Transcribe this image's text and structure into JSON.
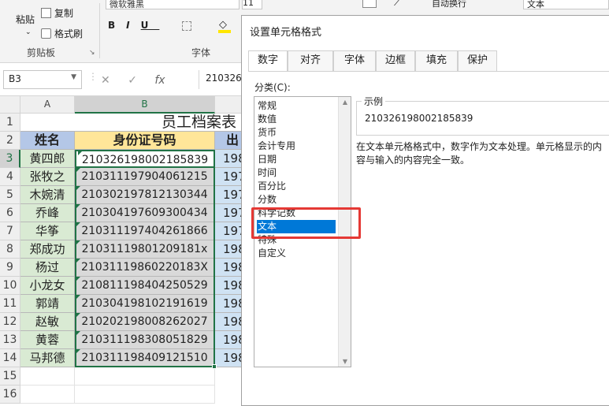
{
  "ribbon": {
    "paste": "粘贴",
    "copy": "复制",
    "format_painter": "格式刷",
    "clipboard_group": "剪贴板",
    "font_name": "微软雅黑",
    "font_size": "11",
    "bold": "B",
    "italic": "I",
    "underline": "U",
    "font_group": "字体",
    "wrap_text": "自动换行",
    "number_format": "文本"
  },
  "formula_bar": {
    "name_box": "B3",
    "fx": "fx",
    "value": "210326198002185839"
  },
  "sheet": {
    "columns": [
      "A",
      "B"
    ],
    "row_numbers": [
      "1",
      "2",
      "3",
      "4",
      "5",
      "6",
      "7",
      "8",
      "9",
      "10",
      "11",
      "12",
      "13",
      "14",
      "15",
      "16"
    ],
    "title": "员工档案表",
    "headers": {
      "name": "姓名",
      "id": "身份证号码",
      "birth": "出"
    },
    "rows": [
      {
        "name": "黄四郎",
        "id": "210326198002185839",
        "birth": "198"
      },
      {
        "name": "张牧之",
        "id": "210311197904061215",
        "birth": "197"
      },
      {
        "name": "木婉清",
        "id": "210302197812130344",
        "birth": "197"
      },
      {
        "name": "乔峰",
        "id": "210304197609300434",
        "birth": "197"
      },
      {
        "name": "华筝",
        "id": "210311197404261866",
        "birth": "197"
      },
      {
        "name": "郑成功",
        "id": "21031119801209181x",
        "birth": "198"
      },
      {
        "name": "杨过",
        "id": "21031119860220183X",
        "birth": "198"
      },
      {
        "name": "小龙女",
        "id": "210811198404250529",
        "birth": "198"
      },
      {
        "name": "郭靖",
        "id": "210304198102191619",
        "birth": "198"
      },
      {
        "name": "赵敏",
        "id": "210202198008262027",
        "birth": "198"
      },
      {
        "name": "黄蓉",
        "id": "210311198308051829",
        "birth": "198"
      },
      {
        "name": "马邦德",
        "id": "210311198409121510",
        "birth": "198"
      }
    ]
  },
  "dialog": {
    "title": "设置单元格格式",
    "tabs": [
      "数字",
      "对齐",
      "字体",
      "边框",
      "填充",
      "保护"
    ],
    "active_tab": "数字",
    "category_label": "分类(C):",
    "categories": [
      "常规",
      "数值",
      "货币",
      "会计专用",
      "日期",
      "时间",
      "百分比",
      "分数",
      "科学记数",
      "文本",
      "特殊",
      "自定义"
    ],
    "selected_category": "文本",
    "sample_label": "示例",
    "sample_value": "210326198002185839",
    "description": "在文本单元格格式中，数字作为文本处理。单元格显示的内容与输入的内容完全一致。"
  },
  "colors": {
    "highlight": "#e53935",
    "selection": "#0078d7",
    "excel_green": "#217346",
    "name_fill": "#d9ead3",
    "header_fill": "#ffe699",
    "id_fill": "#d9d9d9",
    "birth_fill": "#cfe2f3"
  }
}
